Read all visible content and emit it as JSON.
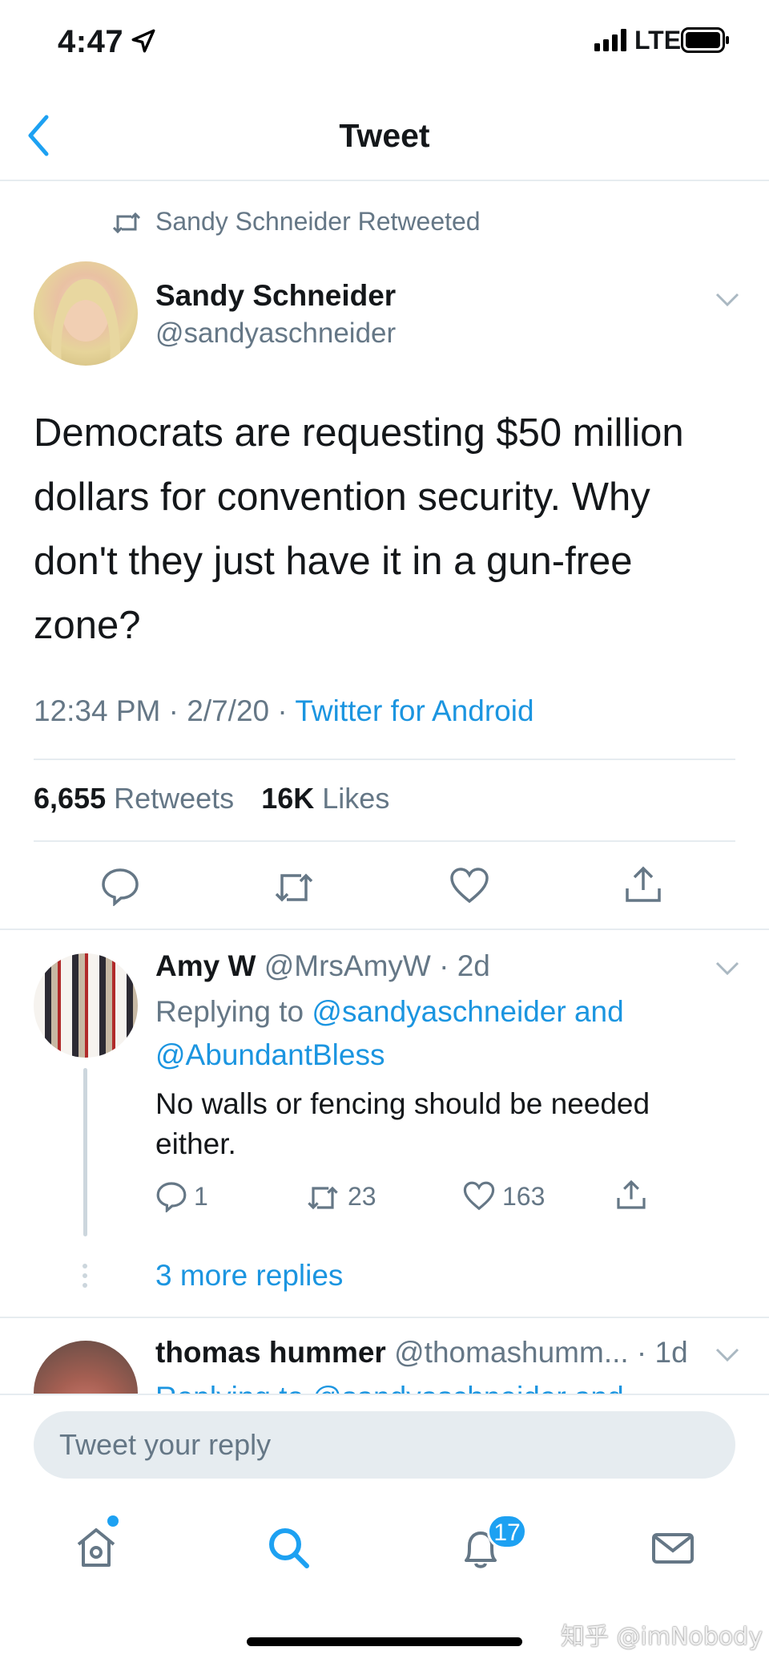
{
  "status_bar": {
    "time": "4:47",
    "network": "LTE"
  },
  "nav": {
    "title": "Tweet"
  },
  "retweet_header": {
    "label": "Sandy Schneider Retweeted"
  },
  "tweet": {
    "author_name": "Sandy Schneider",
    "author_handle": "@sandyaschneider",
    "text": "Democrats are requesting $50 million dollars for convention security. Why don't they just have it in a gun-free zone?",
    "time": "12:34 PM · 2/7/20 · ",
    "source": "Twitter for Android",
    "retweets_count": "6,655",
    "retweets_label": "Retweets",
    "likes_count": "16K",
    "likes_label": "Likes"
  },
  "replies": [
    {
      "author_name": "Amy W",
      "author_handle": "@MrsAmyW",
      "age": " · 2d",
      "replying_prefix": "Replying to ",
      "replying_to": "@sandyaschneider and @AbundantBless",
      "text": "No walls or fencing should be needed either.",
      "reply_count": "1",
      "retweet_count": "23",
      "like_count": "163",
      "more_replies": "3 more replies"
    },
    {
      "author_name": "thomas hummer",
      "author_handle": "@thomashumm...",
      "age": " · 1d",
      "replying_clip": "Replying to @sandyaschneider and"
    }
  ],
  "composer": {
    "placeholder": "Tweet your reply"
  },
  "tab_bar": {
    "notifications_badge": "17"
  },
  "watermark": "知乎 @imNobody",
  "colors": {
    "accent": "#1da1f2",
    "link": "#1b95e0",
    "secondary_text": "#657786",
    "divider": "#e6ecf0"
  },
  "icons": [
    "location-arrow-icon",
    "signal-icon",
    "battery-icon",
    "back-chevron-icon",
    "retweet-icon",
    "chevron-down-icon",
    "reply-icon",
    "heart-icon",
    "share-icon",
    "home-icon",
    "search-icon",
    "bell-icon",
    "mail-icon"
  ]
}
